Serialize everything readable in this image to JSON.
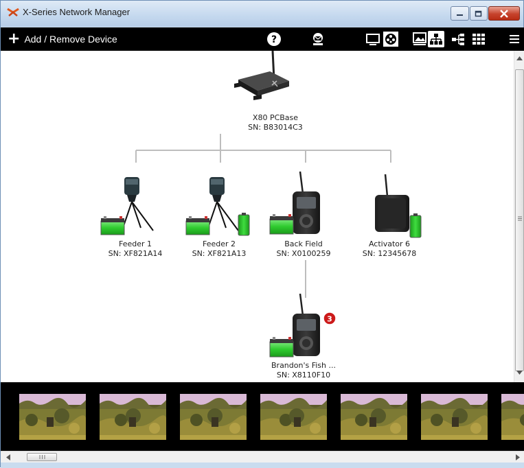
{
  "window": {
    "title": "X-Series Network Manager"
  },
  "toolbar": {
    "add_label": "Add / Remove Device",
    "icons": [
      "help-icon",
      "mail-icon",
      "monitor-icon",
      "video-icon",
      "image-icon",
      "network-tree-icon",
      "network-list-icon",
      "grid-icon",
      "menu-icon"
    ]
  },
  "devices": {
    "base": {
      "name": "X80 PCBase",
      "sn": "SN: B83014C3"
    },
    "feeder1": {
      "name": "Feeder 1",
      "sn": "SN: XF821A14"
    },
    "feeder2": {
      "name": "Feeder 2",
      "sn": "SN: XF821A13"
    },
    "backfield": {
      "name": "Back Field",
      "sn": "SN: X0100259"
    },
    "activator": {
      "name": "Activator 6",
      "sn": "SN: 12345678"
    },
    "brandon": {
      "name": "Brandon's Fish ...",
      "sn": "SN: X8110F10",
      "badge": "3"
    }
  },
  "filmstrip": {
    "count": 7
  },
  "colors": {
    "toolbar_bg": "#000000",
    "battery_green": "#2ecb2e",
    "badge_red": "#cc1a1a"
  }
}
